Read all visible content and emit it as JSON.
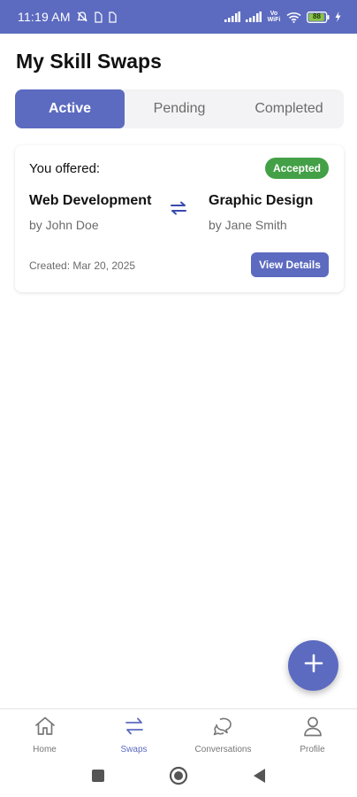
{
  "status_bar": {
    "time": "11:19 AM",
    "wifi_label": "Vo WiFi",
    "battery_level": "88",
    "background_color": "#5c6bc0",
    "icons": [
      "mute-icon",
      "sim-icon",
      "sim-icon",
      "signal-icon",
      "signal-icon",
      "wifi-icon",
      "battery-icon",
      "charging-icon"
    ]
  },
  "header": {
    "title": "My Skill Swaps"
  },
  "tabs": [
    {
      "label": "Active",
      "selected": true
    },
    {
      "label": "Pending",
      "selected": false
    },
    {
      "label": "Completed",
      "selected": false
    }
  ],
  "swap_card": {
    "offer_label": "You offered:",
    "status_badge": "Accepted",
    "status_color": "#43a047",
    "offered_skill": {
      "name": "Web Development",
      "owner": "by John Doe"
    },
    "received_skill": {
      "name": "Graphic Design",
      "owner": "by Jane Smith"
    },
    "swap_icon": "swap-arrows-icon",
    "created": "Created: Mar 20, 2025",
    "view_button": "View Details"
  },
  "fab": {
    "icon": "plus-icon"
  },
  "bottom_nav": [
    {
      "label": "Home",
      "icon": "home-icon",
      "active": false
    },
    {
      "label": "Swaps",
      "icon": "swap-icon",
      "active": true
    },
    {
      "label": "Conversations",
      "icon": "chat-bubbles-icon",
      "active": false
    },
    {
      "label": "Profile",
      "icon": "person-icon",
      "active": false
    }
  ],
  "system_nav": {
    "icons": [
      "recents-square-icon",
      "home-circle-icon",
      "back-triangle-icon"
    ]
  },
  "colors": {
    "primary": "#5c6bc0",
    "accepted": "#43a047",
    "muted_text": "#6b6b6b",
    "tab_background": "#f3f3f5"
  }
}
